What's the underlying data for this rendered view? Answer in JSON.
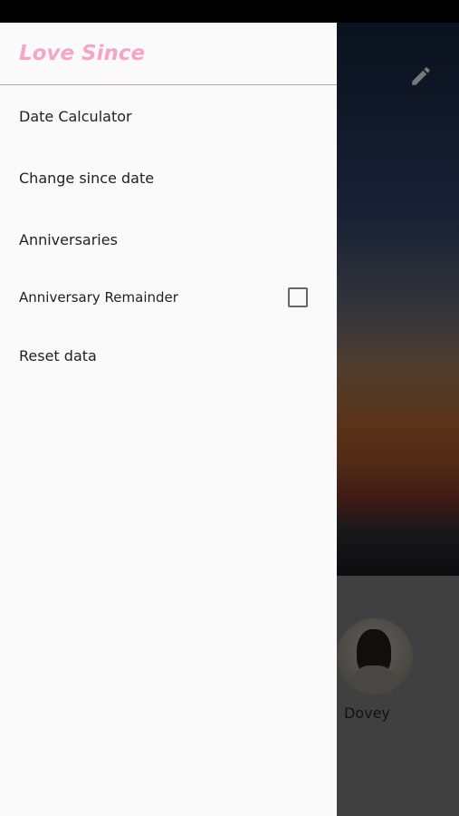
{
  "app": {
    "title": "Love Since"
  },
  "drawer": {
    "items": [
      {
        "label": "Date Calculator"
      },
      {
        "label": "Change since date"
      },
      {
        "label": "Anniversaries"
      },
      {
        "label": "Anniversary Remainder",
        "checked": false
      },
      {
        "label": "Reset data"
      }
    ]
  },
  "background": {
    "partner_name": "Dovey"
  },
  "icons": {
    "edit": "pencil-icon",
    "checkbox": "checkbox-unchecked-icon"
  },
  "colors": {
    "accent": "#f6a5c4",
    "drawer_bg": "#fafafa",
    "divider": "#b8a89a"
  }
}
